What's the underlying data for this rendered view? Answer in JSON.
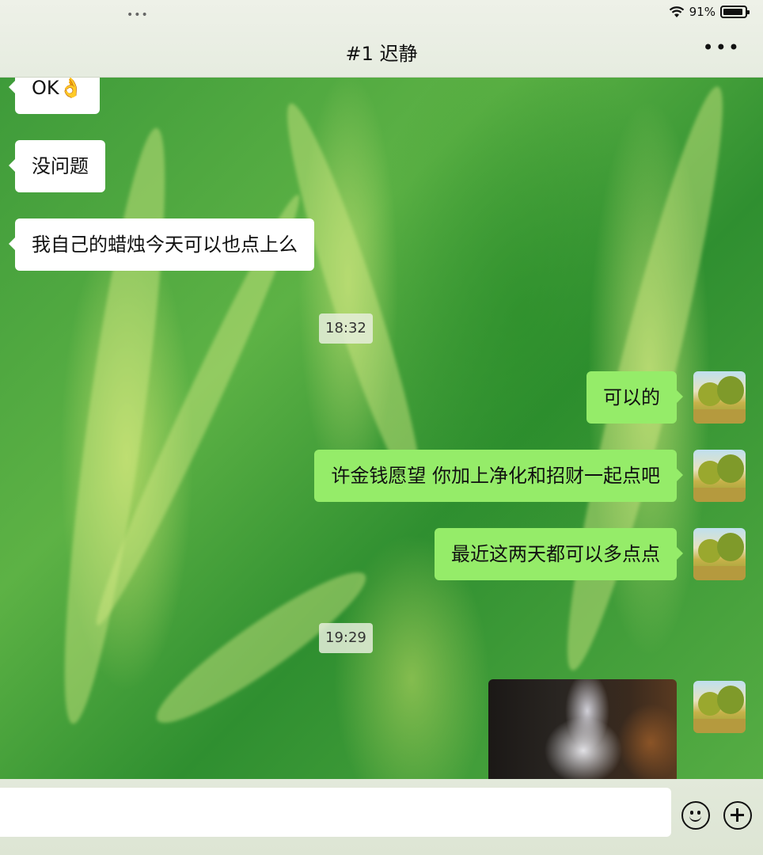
{
  "status_bar": {
    "dots": "•••",
    "wifi_icon": "wifi-icon",
    "battery_text": "91%",
    "battery_level": 0.91
  },
  "header": {
    "title": "#1 迟静",
    "more_icon": "•••"
  },
  "messages": [
    {
      "side": "in",
      "text": "OK👌"
    },
    {
      "side": "in",
      "text": "没问题"
    },
    {
      "side": "in",
      "text": "我自己的蜡烛今天可以也点上么"
    },
    {
      "type": "time",
      "text": "18:32"
    },
    {
      "side": "out",
      "text": "可以的"
    },
    {
      "side": "out",
      "text": "许金钱愿望 你加上净化和招财一起点吧"
    },
    {
      "side": "out",
      "text": "最近这两天都可以多点点"
    },
    {
      "type": "time",
      "text": "19:29"
    },
    {
      "side": "out",
      "type": "image"
    }
  ],
  "input_bar": {
    "emoji_icon": "emoji-icon",
    "add_icon": "plus-circle-icon"
  },
  "colors": {
    "outgoing_bubble": "#95ec69",
    "incoming_bubble": "#ffffff"
  }
}
